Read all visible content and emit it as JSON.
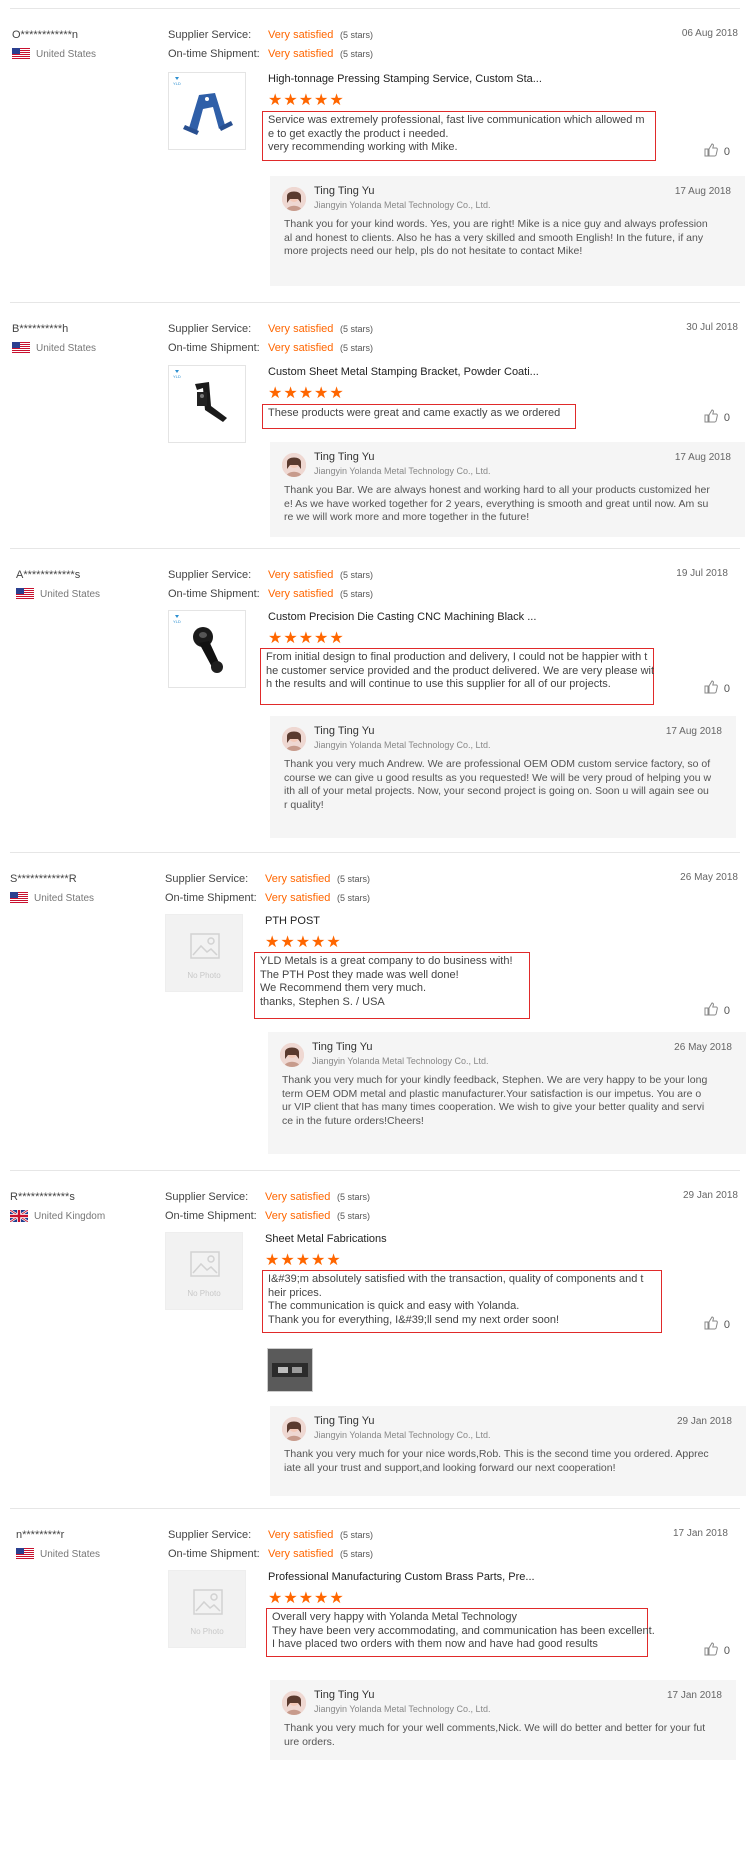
{
  "labels": {
    "supplier_service": "Supplier Service:",
    "ontime_shipment": "On-time Shipment:",
    "no_photo": "No Photo"
  },
  "colors": {
    "accent": "#ff6600",
    "highlight_border": "#e02a2a"
  },
  "reviews": [
    {
      "buyer": "O************n",
      "country": "United States",
      "flag": "us-flag-icon",
      "supplier_service": "Very satisfied",
      "supplier_service_count": "(5 stars)",
      "ontime": "Very satisfied",
      "ontime_count": "(5 stars)",
      "date": "06 Aug 2018",
      "product_title": "High-tonnage Pressing Stamping Service, Custom Sta...",
      "rating": 5,
      "stars": "★★★★★",
      "comment_lines": [
        "Service was extremely professional, fast live communication which allowed m",
        "e to get exactly the product i needed.",
        "very recommending working with Mike."
      ],
      "likes": "0",
      "reply": {
        "name": "Ting Ting Yu",
        "company": "Jiangyin Yolanda Metal Technology Co., Ltd.",
        "date": "17 Aug 2018",
        "lines": [
          "Thank you for your kind words. Yes, you are right! Mike is a nice guy and always profession",
          "al and honest to clients. Also he has a very skilled and smooth English! In the future, if any",
          "more projects need our help, pls do not hesitate to contact Mike!"
        ]
      }
    },
    {
      "buyer": "B**********h",
      "country": "United States",
      "flag": "us-flag-icon",
      "supplier_service": "Very satisfied",
      "supplier_service_count": "(5 stars)",
      "ontime": "Very satisfied",
      "ontime_count": "(5 stars)",
      "date": "30 Jul 2018",
      "product_title": "Custom Sheet Metal Stamping Bracket, Powder Coati...",
      "rating": 5,
      "stars": "★★★★★",
      "comment_lines": [
        "These products were great and came exactly as we ordered"
      ],
      "likes": "0",
      "reply": {
        "name": "Ting Ting Yu",
        "company": "Jiangyin Yolanda Metal Technology Co., Ltd.",
        "date": "17 Aug 2018",
        "lines": [
          "Thank you Bar. We are always honest and working hard to all your products customized her",
          "e! As we have worked together for 2 years, everything is smooth and great until now. Am su",
          "re we will work more and more together in the future!"
        ]
      }
    },
    {
      "buyer": "A************s",
      "country": "United States",
      "flag": "us-flag-icon",
      "supplier_service": "Very satisfied",
      "supplier_service_count": "(5 stars)",
      "ontime": "Very satisfied",
      "ontime_count": "(5 stars)",
      "date": "19 Jul 2018",
      "product_title": "Custom Precision Die Casting CNC Machining Black ...",
      "rating": 5,
      "stars": "★★★★★",
      "comment_lines": [
        "From initial design to final production and delivery, I could not be happier with t",
        "he customer service provided and the product delivered. We are very please wit",
        "h the results and will continue to use this supplier for all of our projects."
      ],
      "likes": "0",
      "reply": {
        "name": "Ting Ting Yu",
        "company": "Jiangyin Yolanda Metal Technology Co., Ltd.",
        "date": "17 Aug 2018",
        "lines": [
          "Thank you very much Andrew. We are professional OEM ODM custom service factory, so of",
          "course we can give u good results as you requested! We will be very proud of helping you w",
          "ith all of your metal projects. Now, your second project is going on. Soon u will again see ou",
          "r quality!"
        ]
      }
    },
    {
      "buyer": "S************R",
      "country": "United States",
      "flag": "us-flag-icon",
      "supplier_service": "Very satisfied",
      "supplier_service_count": "(5 stars)",
      "ontime": "Very satisfied",
      "ontime_count": "(5 stars)",
      "date": "26 May 2018",
      "product_title": "PTH POST",
      "rating": 5,
      "stars": "★★★★★",
      "comment_lines": [
        "YLD Metals is a great company to do business with!",
        "The PTH Post they made was well done!",
        "We Recommend them very much.",
        "thanks, Stephen S. / USA"
      ],
      "likes": "0",
      "reply": {
        "name": "Ting Ting Yu",
        "company": "Jiangyin Yolanda Metal Technology Co., Ltd.",
        "date": "26 May 2018",
        "lines": [
          "Thank you very much for your kindly feedback, Stephen. We are very happy to be your long",
          "term OEM ODM metal and plastic manufacturer.Your satisfaction is our impetus. You are o",
          "ur VIP client that has many times cooperation. We wish to give your better quality and servi",
          "ce in the future orders!Cheers!"
        ]
      }
    },
    {
      "buyer": "R************s",
      "country": "United Kingdom",
      "flag": "uk-flag-icon",
      "supplier_service": "Very satisfied",
      "supplier_service_count": "(5 stars)",
      "ontime": "Very satisfied",
      "ontime_count": "(5 stars)",
      "date": "29 Jan 2018",
      "product_title": "Sheet Metal Fabrications",
      "rating": 5,
      "stars": "★★★★★",
      "comment_lines": [
        "I&#39;m absolutely satisfied with the transaction, quality of components and t",
        "heir prices.",
        "The communication is quick and easy with Yolanda.",
        "Thank you for everything, I&#39;ll send my next order soon!"
      ],
      "likes": "0",
      "reply": {
        "name": "Ting Ting Yu",
        "company": "Jiangyin Yolanda Metal Technology Co., Ltd.",
        "date": "29 Jan 2018",
        "lines": [
          "Thank you very much for your nice words,Rob. This is the second time you ordered. Apprec",
          "iate all your trust and support,and looking forward our next cooperation!"
        ]
      }
    },
    {
      "buyer": "n*********r",
      "country": "United States",
      "flag": "us-flag-icon",
      "supplier_service": "Very satisfied",
      "supplier_service_count": "(5 stars)",
      "ontime": "Very satisfied",
      "ontime_count": "(5 stars)",
      "date": "17 Jan 2018",
      "product_title": "Professional Manufacturing Custom Brass Parts, Pre...",
      "rating": 5,
      "stars": "★★★★★",
      "comment_lines": [
        "Overall very happy with Yolanda Metal Technology",
        "They have been very accommodating, and communication has been excellent.",
        "I have placed two orders with them now and have had good results"
      ],
      "likes": "0",
      "reply": {
        "name": "Ting Ting Yu",
        "company": "Jiangyin Yolanda Metal Technology Co., Ltd.",
        "date": "17 Jan 2018",
        "lines": [
          "Thank you very much for your well comments,Nick. We will do better and better for your fut",
          "ure orders."
        ]
      }
    }
  ]
}
